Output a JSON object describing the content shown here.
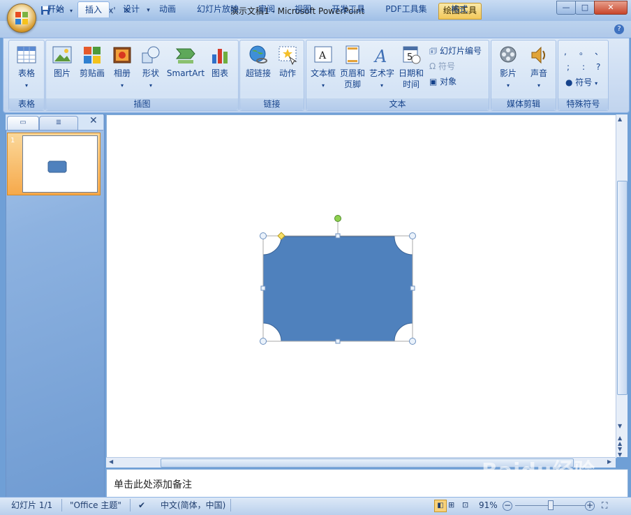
{
  "window": {
    "title": "演示文稿1 - Microsoft PowerPoint",
    "contextual_tab": "绘图工具",
    "minimize": "—",
    "maximize": "□",
    "close": "✕"
  },
  "tabs": [
    {
      "label": "开始"
    },
    {
      "label": "插入",
      "active": true
    },
    {
      "label": "设计"
    },
    {
      "label": "动画"
    },
    {
      "label": "幻灯片放映"
    },
    {
      "label": "审阅"
    },
    {
      "label": "视图"
    },
    {
      "label": "开发工具"
    },
    {
      "label": "PDF工具集"
    },
    {
      "label": "格式"
    }
  ],
  "ribbon": {
    "groups": {
      "table": {
        "label": "表格",
        "items": [
          "表格"
        ]
      },
      "illustrations": {
        "label": "插图",
        "items": [
          "图片",
          "剪贴画",
          "相册",
          "形状",
          "SmartArt",
          "图表"
        ]
      },
      "links": {
        "label": "链接",
        "items": [
          "超链接",
          "动作"
        ]
      },
      "text": {
        "label": "文本",
        "items": [
          "文本框",
          "页眉和",
          "页脚",
          "艺术字",
          "日期和",
          "时间"
        ],
        "small_items": [
          "幻灯片编号",
          "符号",
          "对象"
        ]
      },
      "media": {
        "label": "媒体剪辑",
        "items": [
          "影片",
          "声音"
        ]
      },
      "special": {
        "label": "特殊符号",
        "items": [
          "符号"
        ],
        "glyphs": [
          ",",
          "。",
          "、",
          ";",
          ":",
          "?"
        ]
      }
    }
  },
  "slides_pane": {
    "slide_number": "1"
  },
  "notes": {
    "placeholder": "单击此处添加备注"
  },
  "status": {
    "slide": "幻灯片 1/1",
    "theme": "\"Office 主题\"",
    "language": "中文(简体，中国)",
    "zoom": "91%",
    "zoom_level": 0.5
  },
  "watermark": {
    "text": "Baidu经验",
    "url": "jingyan.baidu.com"
  },
  "colors": {
    "shape_fill": "#4f81bd",
    "shape_stroke": "#3a6396",
    "accent_orange": "#f6a94b",
    "ribbon_blue": "#15428b"
  }
}
